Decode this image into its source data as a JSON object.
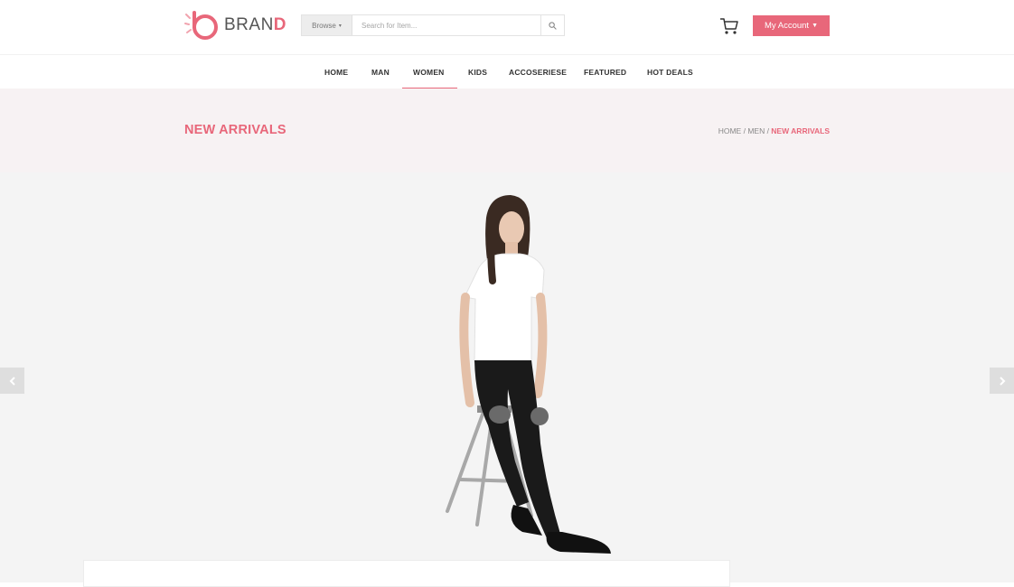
{
  "header": {
    "logo": {
      "text_main": "BRAN",
      "text_last": "D"
    },
    "search": {
      "browse_label": "Browse",
      "placeholder": "Search for Item..."
    },
    "account_label": "My Account"
  },
  "nav": {
    "items": [
      {
        "label": "HOME"
      },
      {
        "label": "MAN"
      },
      {
        "label": "WOMEN",
        "active": true
      },
      {
        "label": "KIDS"
      },
      {
        "label": "ACCOSERIESE"
      },
      {
        "label": "FEATURED"
      },
      {
        "label": "HOT DEALS"
      }
    ]
  },
  "hero": {
    "title": "NEW ARRIVALS",
    "breadcrumb": {
      "home": "HOME",
      "sep1": " / ",
      "section": "MEN",
      "sep2": " / ",
      "current": "NEW ARRIVALS"
    }
  },
  "gallery": {
    "prev_icon": "chevron-left-icon",
    "next_icon": "chevron-right-icon"
  },
  "colors": {
    "accent": "#e8677a",
    "hero_bg": "#f7f2f3",
    "gallery_bg": "#f4f4f4"
  }
}
